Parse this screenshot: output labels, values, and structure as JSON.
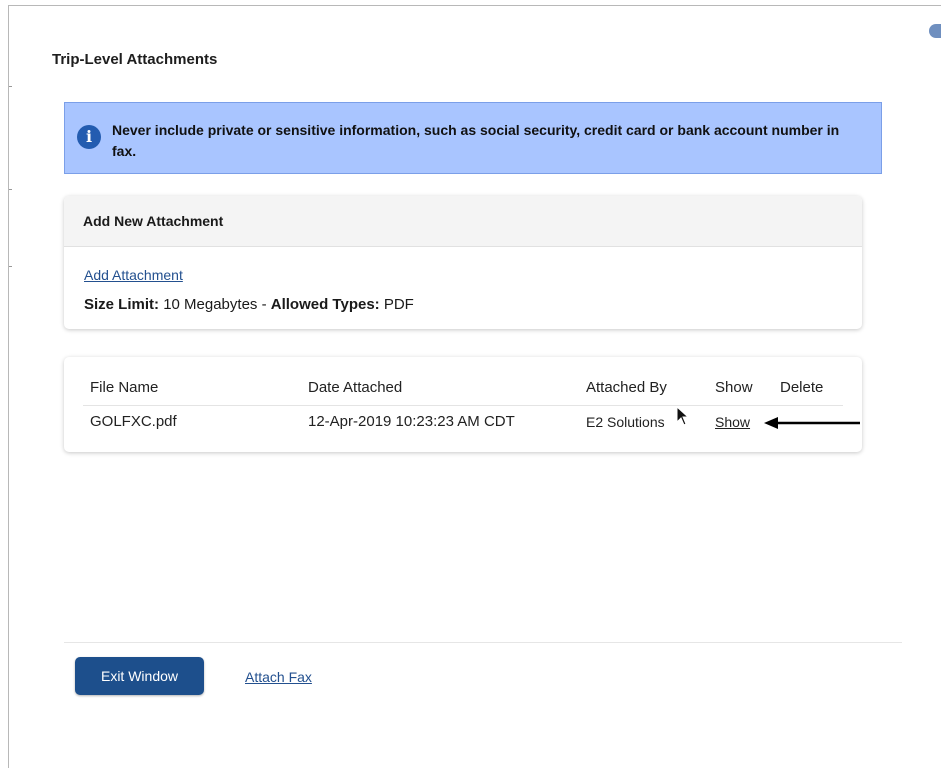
{
  "page": {
    "title": "Trip-Level Attachments"
  },
  "alert": {
    "icon": "info-icon",
    "message": "Never include private or sensitive information, such as social security, credit card or bank account number in fax."
  },
  "new_attachment": {
    "header": "Add New Attachment",
    "add_link": "Add Attachment",
    "size_limit_label": "Size Limit:",
    "size_limit_value": "10 Megabytes",
    "separator": "-",
    "allowed_types_label": "Allowed Types:",
    "allowed_types_value": "PDF"
  },
  "attachments_table": {
    "headers": {
      "file_name": "File Name",
      "date_attached": "Date Attached",
      "attached_by": "Attached By",
      "show": "Show",
      "delete": "Delete"
    },
    "rows": [
      {
        "file_name": "GOLFXC.pdf",
        "date_attached": "12-Apr-2019 10:23:23 AM CDT",
        "attached_by": "E2 Solutions",
        "show_link": "Show"
      }
    ]
  },
  "footer": {
    "exit_button": "Exit Window",
    "attach_fax_link": "Attach Fax"
  },
  "colors": {
    "alert_background": "#a9c5ff",
    "primary_button": "#1d4f8c",
    "link": "#23508f"
  }
}
